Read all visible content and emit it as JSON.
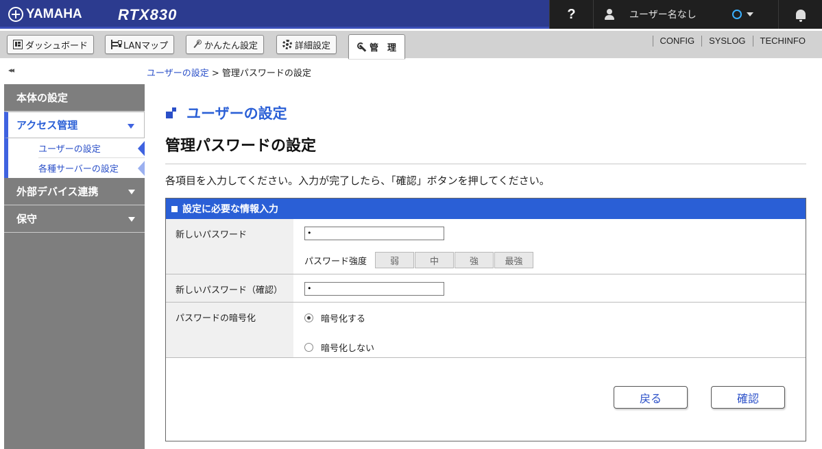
{
  "header": {
    "brand": "YAMAHA",
    "model": "RTX830",
    "help": "?",
    "user": "ユーザー名なし"
  },
  "menu": {
    "items": [
      {
        "label": "ダッシュボード",
        "icon": "dashboard-icon"
      },
      {
        "label": "LANマップ",
        "icon": "lan-map-icon"
      },
      {
        "label": "かんたん設定",
        "icon": "wand-icon"
      },
      {
        "label": "詳細設定",
        "icon": "gear-icon"
      },
      {
        "label": "管　理",
        "icon": "wrench-icon",
        "active": true
      }
    ],
    "links": [
      "CONFIG",
      "SYSLOG",
      "TECHINFO"
    ]
  },
  "sidebar": {
    "collapse": "◂◂",
    "sections": [
      {
        "label": "本体の設定"
      },
      {
        "label": "アクセス管理",
        "open": true,
        "subitems": [
          "ユーザーの設定",
          "各種サーバーの設定"
        ]
      },
      {
        "label": "外部デバイス連携"
      },
      {
        "label": "保守"
      }
    ]
  },
  "breadcrumb": {
    "parent": "ユーザーの設定",
    "sep": " > ",
    "current": "管理パスワードの設定"
  },
  "page": {
    "section_title": "ユーザーの設定",
    "title": "管理パスワードの設定",
    "description": "各項目を入力してください。入力が完了したら、「確認」ボタンを押してください。"
  },
  "form": {
    "heading": "設定に必要な情報入力",
    "new_password_label": "新しいパスワード",
    "new_password_value": "•",
    "strength_label": "パスワード強度",
    "strength_levels": [
      "弱",
      "中",
      "強",
      "最強"
    ],
    "confirm_password_label": "新しいパスワード（確認）",
    "confirm_password_value": "•",
    "encrypt_label": "パスワードの暗号化",
    "encrypt_on": "暗号化する",
    "encrypt_off": "暗号化しない",
    "encrypt_selected": "on",
    "back_button": "戻る",
    "confirm_button": "確認"
  },
  "colors": {
    "header_bg": "#2c3b8f",
    "accent": "#2a5fd6",
    "sidebar_bg": "#7e7e7e"
  }
}
